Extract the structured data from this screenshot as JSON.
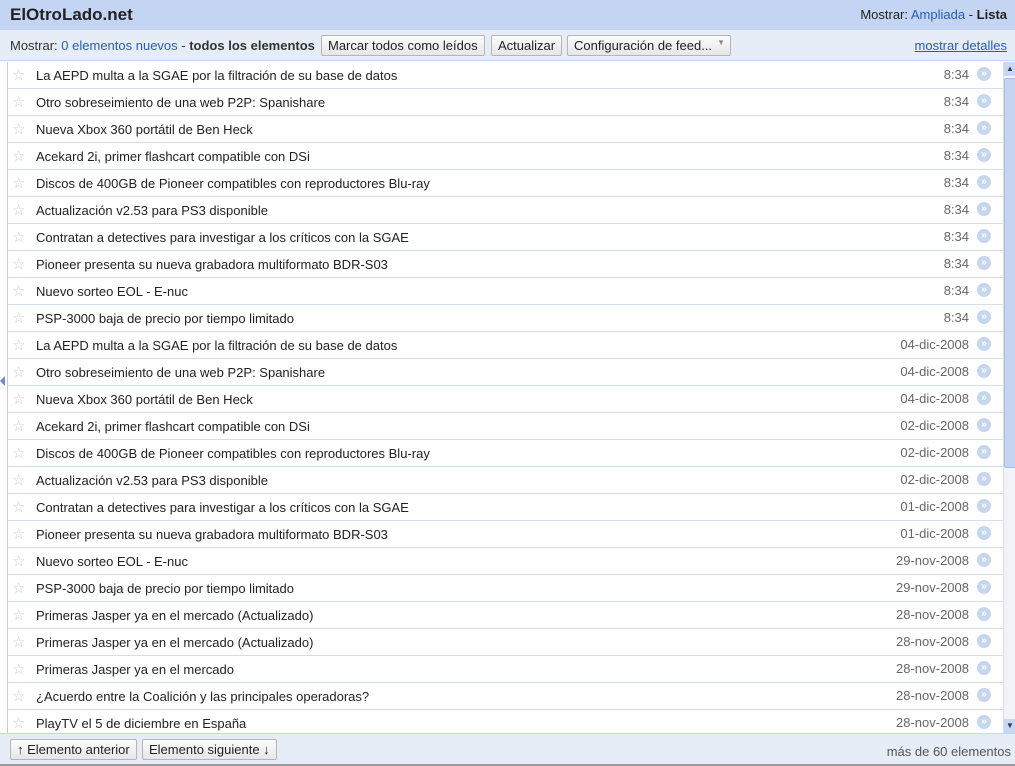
{
  "header": {
    "title": "ElOtroLado.net",
    "view_label": "Mostrar:",
    "view_expanded": "Ampliada",
    "view_sep": " - ",
    "view_list": "Lista"
  },
  "toolbar": {
    "show_label": "Mostrar:",
    "new_items": "0 elementos nuevos",
    "sep": " - ",
    "all_items": "todos los elementos",
    "mark_all_read": "Marcar todos como leídos",
    "refresh": "Actualizar",
    "feed_settings": "Configuración de feed...",
    "show_details": "mostrar detalles"
  },
  "items": [
    {
      "title": "La AEPD multa a la SGAE por la filtración de su base de datos",
      "date": "8:34"
    },
    {
      "title": "Otro sobreseimiento de una web P2P: Spanishare",
      "date": "8:34"
    },
    {
      "title": "Nueva Xbox 360 portátil de Ben Heck",
      "date": "8:34"
    },
    {
      "title": "Acekard 2i, primer flashcart compatible con DSi",
      "date": "8:34"
    },
    {
      "title": "Discos de 400GB de Pioneer compatibles con reproductores Blu-ray",
      "date": "8:34"
    },
    {
      "title": "Actualización v2.53 para PS3 disponible",
      "date": "8:34"
    },
    {
      "title": "Contratan a detectives para investigar a los críticos con la SGAE",
      "date": "8:34"
    },
    {
      "title": "Pioneer presenta su nueva grabadora multiformato BDR-S03",
      "date": "8:34"
    },
    {
      "title": "Nuevo sorteo EOL - E-nuc",
      "date": "8:34"
    },
    {
      "title": "PSP-3000 baja de precio por tiempo limitado",
      "date": "8:34"
    },
    {
      "title": "La AEPD multa a la SGAE por la filtración de su base de datos",
      "date": "04-dic-2008"
    },
    {
      "title": "Otro sobreseimiento de una web P2P: Spanishare",
      "date": "04-dic-2008"
    },
    {
      "title": "Nueva Xbox 360 portátil de Ben Heck",
      "date": "04-dic-2008"
    },
    {
      "title": "Acekard 2i, primer flashcart compatible con DSi",
      "date": "02-dic-2008"
    },
    {
      "title": "Discos de 400GB de Pioneer compatibles con reproductores Blu-ray",
      "date": "02-dic-2008"
    },
    {
      "title": "Actualización v2.53 para PS3 disponible",
      "date": "02-dic-2008"
    },
    {
      "title": "Contratan a detectives para investigar a los críticos con la SGAE",
      "date": "01-dic-2008"
    },
    {
      "title": "Pioneer presenta su nueva grabadora multiformato BDR-S03",
      "date": "01-dic-2008"
    },
    {
      "title": "Nuevo sorteo EOL - E-nuc",
      "date": "29-nov-2008"
    },
    {
      "title": "PSP-3000 baja de precio por tiempo limitado",
      "date": "29-nov-2008"
    },
    {
      "title": "Primeras Jasper ya en el mercado (Actualizado)",
      "date": "28-nov-2008"
    },
    {
      "title": "Primeras Jasper ya en el mercado (Actualizado)",
      "date": "28-nov-2008"
    },
    {
      "title": "Primeras Jasper ya en el mercado",
      "date": "28-nov-2008"
    },
    {
      "title": "¿Acuerdo entre la Coalición y las principales operadoras?",
      "date": "28-nov-2008"
    },
    {
      "title": "PlayTV el 5 de diciembre en España",
      "date": "28-nov-2008"
    }
  ],
  "footer": {
    "prev": "↑ Elemento anterior",
    "next": "Elemento siguiente ↓",
    "count": "más de 60 elementos"
  }
}
